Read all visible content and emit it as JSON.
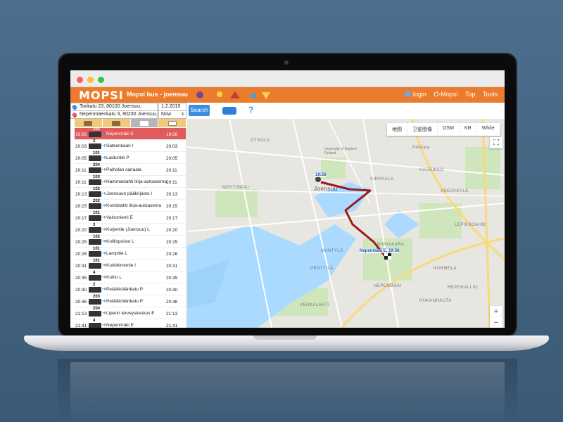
{
  "app": {
    "logo": "MOPSI",
    "title": "Mopsi bus - joensuu",
    "nav": [
      "login",
      "O-Mopsi",
      "Top",
      "Tools"
    ]
  },
  "search": {
    "from": "Torikatu 23, 80100 Joensuu,",
    "to": "Nepenmäenkatu 3, 80230 Joensuu,",
    "date": "1.2.2019",
    "time": "Now",
    "button": "Search",
    "help": "?"
  },
  "routes": [
    {
      "dep": "19:56",
      "line": "102",
      "stop": "Nepenmäki E",
      "arr": "19:56",
      "selected": true
    },
    {
      "dep": "20:03",
      "line": "2",
      "stop": "Sateenkaari I",
      "arr": "20:03"
    },
    {
      "dep": "20:05",
      "line": "101",
      "stop": "Laiduntie P",
      "arr": "20:05"
    },
    {
      "dep": "20:11",
      "line": "204",
      "stop": "Paiholan sairaala",
      "arr": "20:11"
    },
    {
      "dep": "20:11",
      "line": "103",
      "stop": "Hammastahti linja-autoasema",
      "arr": "20:11"
    },
    {
      "dep": "20:13",
      "line": "102",
      "stop": "Joensuun pääkirjasto I",
      "arr": "20:13"
    },
    {
      "dep": "20:15",
      "line": "202",
      "stop": "Kontiolahti linja-autoasema",
      "arr": "20:15"
    },
    {
      "dep": "20:17",
      "line": "101",
      "stop": "Vainoniemi E",
      "arr": "20:17"
    },
    {
      "dep": "20:20",
      "line": "3",
      "stop": "Kurjentie (Joensuu) L",
      "arr": "20:20"
    },
    {
      "dep": "20:25",
      "line": "102",
      "stop": "Koillispuisto L",
      "arr": "20:25"
    },
    {
      "dep": "20:26",
      "line": "101",
      "stop": "Lampitie L",
      "arr": "20:26"
    },
    {
      "dep": "20:31",
      "line": "101",
      "stop": "Kurkihirrentie I",
      "arr": "20:31"
    },
    {
      "dep": "20:35",
      "line": "4",
      "stop": "Kuiho L",
      "arr": "20:35"
    },
    {
      "dep": "20:40",
      "line": "2",
      "stop": "Petäikkölänkatu P",
      "arr": "20:40"
    },
    {
      "dep": "20:46",
      "line": "203",
      "stop": "Petäikkölänkatu P",
      "arr": "20:46"
    },
    {
      "dep": "21:13",
      "line": "204",
      "stop": "Liperin terveyskeskus E",
      "arr": "21:13"
    },
    {
      "dep": "21:41",
      "line": "4",
      "stop": "Nepenmäki E",
      "arr": "21:41"
    }
  ],
  "map": {
    "types": [
      "地图",
      "卫星图像",
      "OSM",
      "KR",
      "White"
    ],
    "labels": {
      "otsola": "OTSOLA",
      "mehtimaki": "MEHTIMÄKI",
      "joensuu": "Joensuu",
      "karsikko": "KARSIKKO",
      "sirkkala": "SIRKKALA",
      "aseviikylä": "ASEVIIKYLÄ",
      "lepikkoaho": "LEPIKKOAHO",
      "niinivaara": "NIINIVAARA",
      "mantyla": "MÄNTYLÄ",
      "penttila": "PENTTILÄ",
      "nepenmaki": "NEPENMÄKI",
      "nurmela": "NURMELA",
      "repokallio": "REPOKALLIO",
      "vehkalahti": "VEHKALAHTI",
      "hukanhauta": "HUKANHAUTA",
      "pekkala": "Pekkala",
      "uni": "University of Eastern Finland"
    },
    "start_label": "19:56",
    "end_label": "Nepenmäki E, 19:56",
    "zoom_in": "+",
    "zoom_out": "−",
    "fullscreen": "⛶"
  },
  "colors": {
    "accent": "#ec7c2d",
    "selected_row": "#e05b5b",
    "route": "#9b1b1b",
    "button": "#3a8de0"
  }
}
